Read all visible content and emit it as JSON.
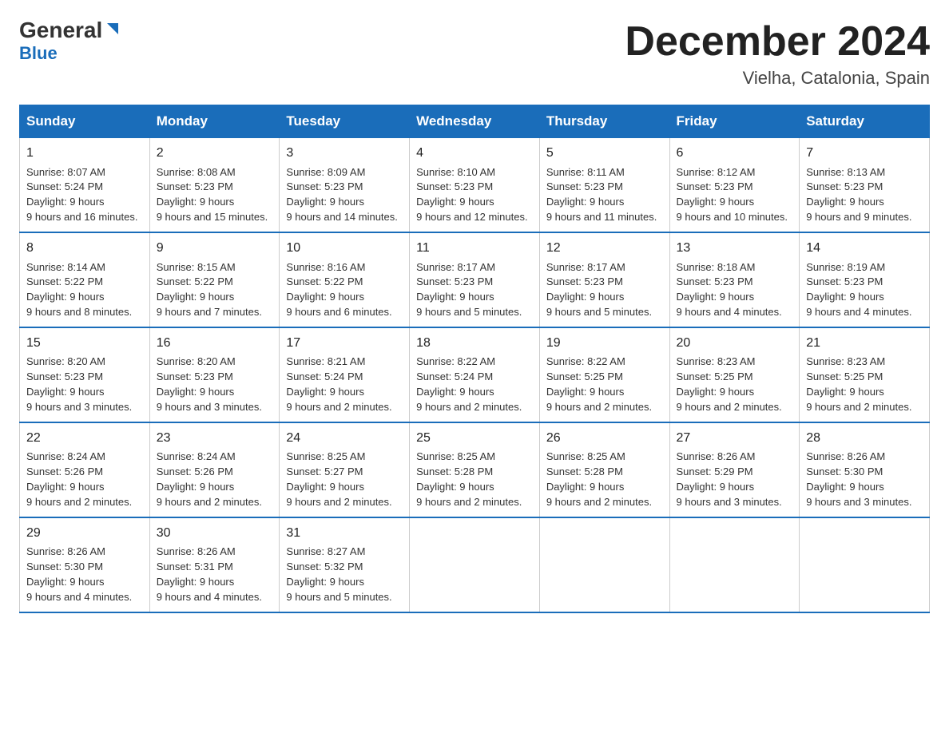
{
  "logo": {
    "text_general": "General",
    "text_blue": "Blue",
    "subtitle": "Blue"
  },
  "header": {
    "month_title": "December 2024",
    "location": "Vielha, Catalonia, Spain"
  },
  "days_of_week": [
    "Sunday",
    "Monday",
    "Tuesday",
    "Wednesday",
    "Thursday",
    "Friday",
    "Saturday"
  ],
  "weeks": [
    [
      {
        "day": "1",
        "sunrise": "8:07 AM",
        "sunset": "5:24 PM",
        "daylight": "9 hours and 16 minutes."
      },
      {
        "day": "2",
        "sunrise": "8:08 AM",
        "sunset": "5:23 PM",
        "daylight": "9 hours and 15 minutes."
      },
      {
        "day": "3",
        "sunrise": "8:09 AM",
        "sunset": "5:23 PM",
        "daylight": "9 hours and 14 minutes."
      },
      {
        "day": "4",
        "sunrise": "8:10 AM",
        "sunset": "5:23 PM",
        "daylight": "9 hours and 12 minutes."
      },
      {
        "day": "5",
        "sunrise": "8:11 AM",
        "sunset": "5:23 PM",
        "daylight": "9 hours and 11 minutes."
      },
      {
        "day": "6",
        "sunrise": "8:12 AM",
        "sunset": "5:23 PM",
        "daylight": "9 hours and 10 minutes."
      },
      {
        "day": "7",
        "sunrise": "8:13 AM",
        "sunset": "5:23 PM",
        "daylight": "9 hours and 9 minutes."
      }
    ],
    [
      {
        "day": "8",
        "sunrise": "8:14 AM",
        "sunset": "5:22 PM",
        "daylight": "9 hours and 8 minutes."
      },
      {
        "day": "9",
        "sunrise": "8:15 AM",
        "sunset": "5:22 PM",
        "daylight": "9 hours and 7 minutes."
      },
      {
        "day": "10",
        "sunrise": "8:16 AM",
        "sunset": "5:22 PM",
        "daylight": "9 hours and 6 minutes."
      },
      {
        "day": "11",
        "sunrise": "8:17 AM",
        "sunset": "5:23 PM",
        "daylight": "9 hours and 5 minutes."
      },
      {
        "day": "12",
        "sunrise": "8:17 AM",
        "sunset": "5:23 PM",
        "daylight": "9 hours and 5 minutes."
      },
      {
        "day": "13",
        "sunrise": "8:18 AM",
        "sunset": "5:23 PM",
        "daylight": "9 hours and 4 minutes."
      },
      {
        "day": "14",
        "sunrise": "8:19 AM",
        "sunset": "5:23 PM",
        "daylight": "9 hours and 4 minutes."
      }
    ],
    [
      {
        "day": "15",
        "sunrise": "8:20 AM",
        "sunset": "5:23 PM",
        "daylight": "9 hours and 3 minutes."
      },
      {
        "day": "16",
        "sunrise": "8:20 AM",
        "sunset": "5:23 PM",
        "daylight": "9 hours and 3 minutes."
      },
      {
        "day": "17",
        "sunrise": "8:21 AM",
        "sunset": "5:24 PM",
        "daylight": "9 hours and 2 minutes."
      },
      {
        "day": "18",
        "sunrise": "8:22 AM",
        "sunset": "5:24 PM",
        "daylight": "9 hours and 2 minutes."
      },
      {
        "day": "19",
        "sunrise": "8:22 AM",
        "sunset": "5:25 PM",
        "daylight": "9 hours and 2 minutes."
      },
      {
        "day": "20",
        "sunrise": "8:23 AM",
        "sunset": "5:25 PM",
        "daylight": "9 hours and 2 minutes."
      },
      {
        "day": "21",
        "sunrise": "8:23 AM",
        "sunset": "5:25 PM",
        "daylight": "9 hours and 2 minutes."
      }
    ],
    [
      {
        "day": "22",
        "sunrise": "8:24 AM",
        "sunset": "5:26 PM",
        "daylight": "9 hours and 2 minutes."
      },
      {
        "day": "23",
        "sunrise": "8:24 AM",
        "sunset": "5:26 PM",
        "daylight": "9 hours and 2 minutes."
      },
      {
        "day": "24",
        "sunrise": "8:25 AM",
        "sunset": "5:27 PM",
        "daylight": "9 hours and 2 minutes."
      },
      {
        "day": "25",
        "sunrise": "8:25 AM",
        "sunset": "5:28 PM",
        "daylight": "9 hours and 2 minutes."
      },
      {
        "day": "26",
        "sunrise": "8:25 AM",
        "sunset": "5:28 PM",
        "daylight": "9 hours and 2 minutes."
      },
      {
        "day": "27",
        "sunrise": "8:26 AM",
        "sunset": "5:29 PM",
        "daylight": "9 hours and 3 minutes."
      },
      {
        "day": "28",
        "sunrise": "8:26 AM",
        "sunset": "5:30 PM",
        "daylight": "9 hours and 3 minutes."
      }
    ],
    [
      {
        "day": "29",
        "sunrise": "8:26 AM",
        "sunset": "5:30 PM",
        "daylight": "9 hours and 4 minutes."
      },
      {
        "day": "30",
        "sunrise": "8:26 AM",
        "sunset": "5:31 PM",
        "daylight": "9 hours and 4 minutes."
      },
      {
        "day": "31",
        "sunrise": "8:27 AM",
        "sunset": "5:32 PM",
        "daylight": "9 hours and 5 minutes."
      },
      null,
      null,
      null,
      null
    ]
  ]
}
